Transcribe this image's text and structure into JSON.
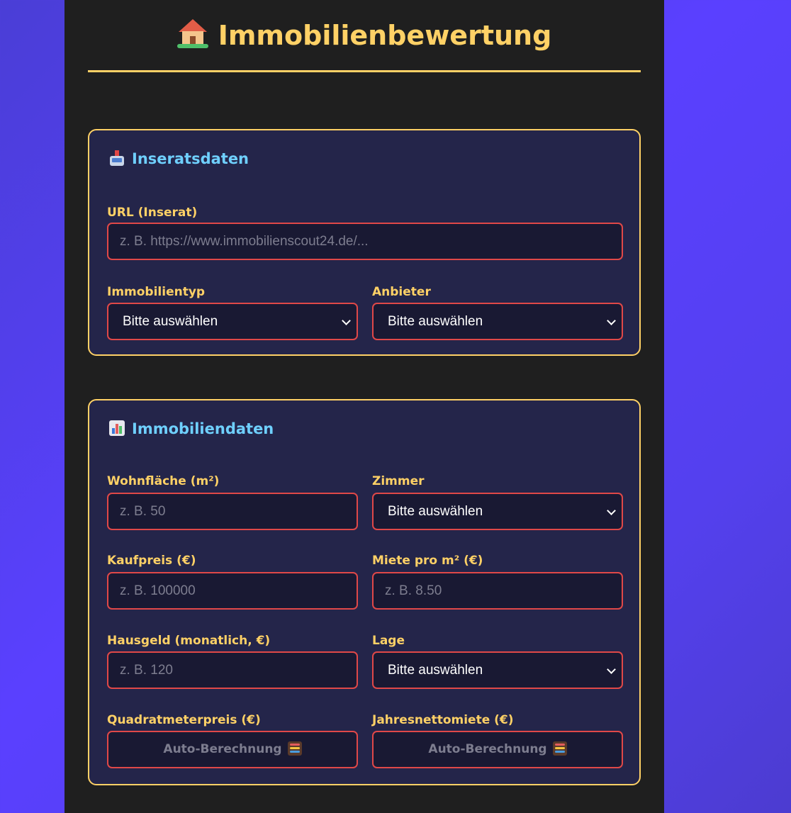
{
  "page": {
    "title": "Immobilienbewertung",
    "title_icon": "house-with-garden-icon"
  },
  "colors": {
    "accent": "#ffd166",
    "section_title": "#6fd0ff",
    "field_border": "#e04848",
    "panel": "#1f1f1f",
    "card": "#24254a"
  },
  "inseratsdaten": {
    "title": "Inseratsdaten",
    "icon": "inbox-tray-icon",
    "url_label": "URL (Inserat)",
    "url_placeholder": "z. B. https://www.immobilienscout24.de/...",
    "immobilientyp_label": "Immobilientyp",
    "immobilientyp_value": "Bitte auswählen",
    "anbieter_label": "Anbieter",
    "anbieter_value": "Bitte auswählen"
  },
  "immobiliendaten": {
    "title": "Immobiliendaten",
    "icon": "bar-chart-icon",
    "wohnflaeche_label": "Wohnfläche (m²)",
    "wohnflaeche_placeholder": "z. B. 50",
    "zimmer_label": "Zimmer",
    "zimmer_value": "Bitte auswählen",
    "kaufpreis_label": "Kaufpreis (€)",
    "kaufpreis_placeholder": "z. B. 100000",
    "miete_label": "Miete pro m² (€)",
    "miete_placeholder": "z. B. 8.50",
    "hausgeld_label": "Hausgeld (monatlich, €)",
    "hausgeld_placeholder": "z. B. 120",
    "lage_label": "Lage",
    "lage_value": "Bitte auswählen",
    "qm_preis_label": "Quadratmeterpreis (€)",
    "qm_preis_value": "Auto-Berechnung",
    "jahresnettomiete_label": "Jahresnettomiete (€)",
    "jahresnettomiete_value": "Auto-Berechnung",
    "auto_icon": "abacus-icon"
  }
}
